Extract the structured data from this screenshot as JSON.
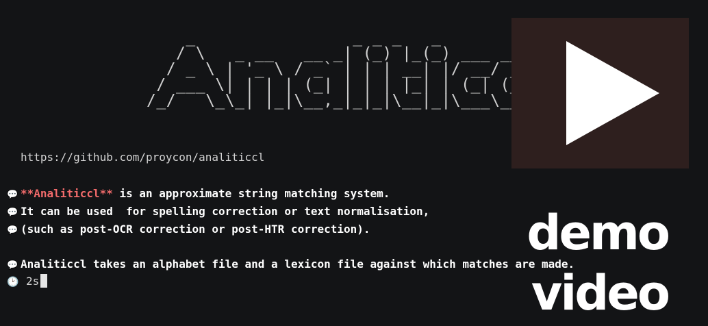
{
  "banner": {
    "ascii_logo": "    _                _ _ _   _          _ \n   / \\   _ __   __ _| (_) |_(_) ___ ___| |\n  / _ \\ | '_ \\ / _` | | | __| |/ __/ __| |\n / ___ \\| | | | (_| | | | |_| | (_| (__| |\n/_/   \\_\\_| |_|\\__,_|_|_|\\__|_|\\___\\___|_|",
    "url": "https://github.com/proycon/analiticcl"
  },
  "terminal": {
    "bubble_glyph": "💬",
    "line1_highlight": "**Analiticcl**",
    "line1_rest": " is an approximate string matching system.",
    "line2": "It can be used  for spelling correction or text normalisation,",
    "line3": "(such as post-OCR correction or post-HTR correction).",
    "line4": "Analiticcl takes an alphabet file and a lexicon file against which matches are made.",
    "clock_glyph": "🕑",
    "elapsed": "2s"
  },
  "video_overlay": {
    "play_icon": "play-icon",
    "label_line1": "demo",
    "label_line2": "video"
  },
  "colors": {
    "background": "#131416",
    "highlight": "#f26b6b",
    "video_box": "#2e1f1e"
  }
}
